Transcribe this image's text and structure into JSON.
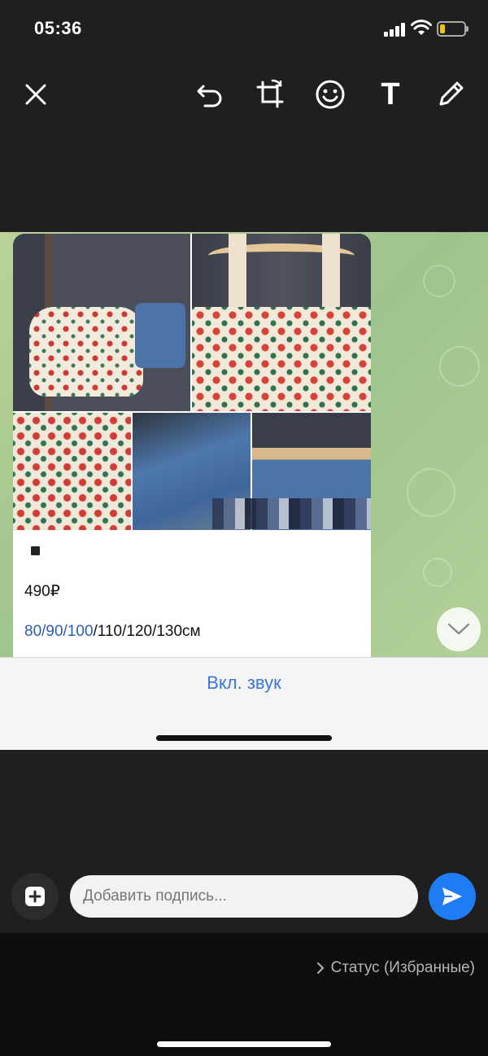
{
  "status_bar": {
    "time": "05:36",
    "battery_level": 0.2,
    "battery_color": "#f5c400"
  },
  "toolbar": {
    "icons": [
      "close-icon",
      "undo-icon",
      "crop-rotate-icon",
      "emoji-icon",
      "text-icon",
      "pencil-icon"
    ],
    "text_tool_label": "T"
  },
  "preview": {
    "message": {
      "price": "490₽",
      "sizes_links": "80/90/100",
      "sizes_rest": "/110/120/130см"
    },
    "sound_toggle_label": "Вкл. звук"
  },
  "caption": {
    "placeholder": "Добавить подпись..."
  },
  "recipient": {
    "label": "Статус (Избранные)"
  },
  "colors": {
    "accent": "#1f7cf2",
    "link": "#3478d6",
    "background": "#1f1f1f"
  }
}
